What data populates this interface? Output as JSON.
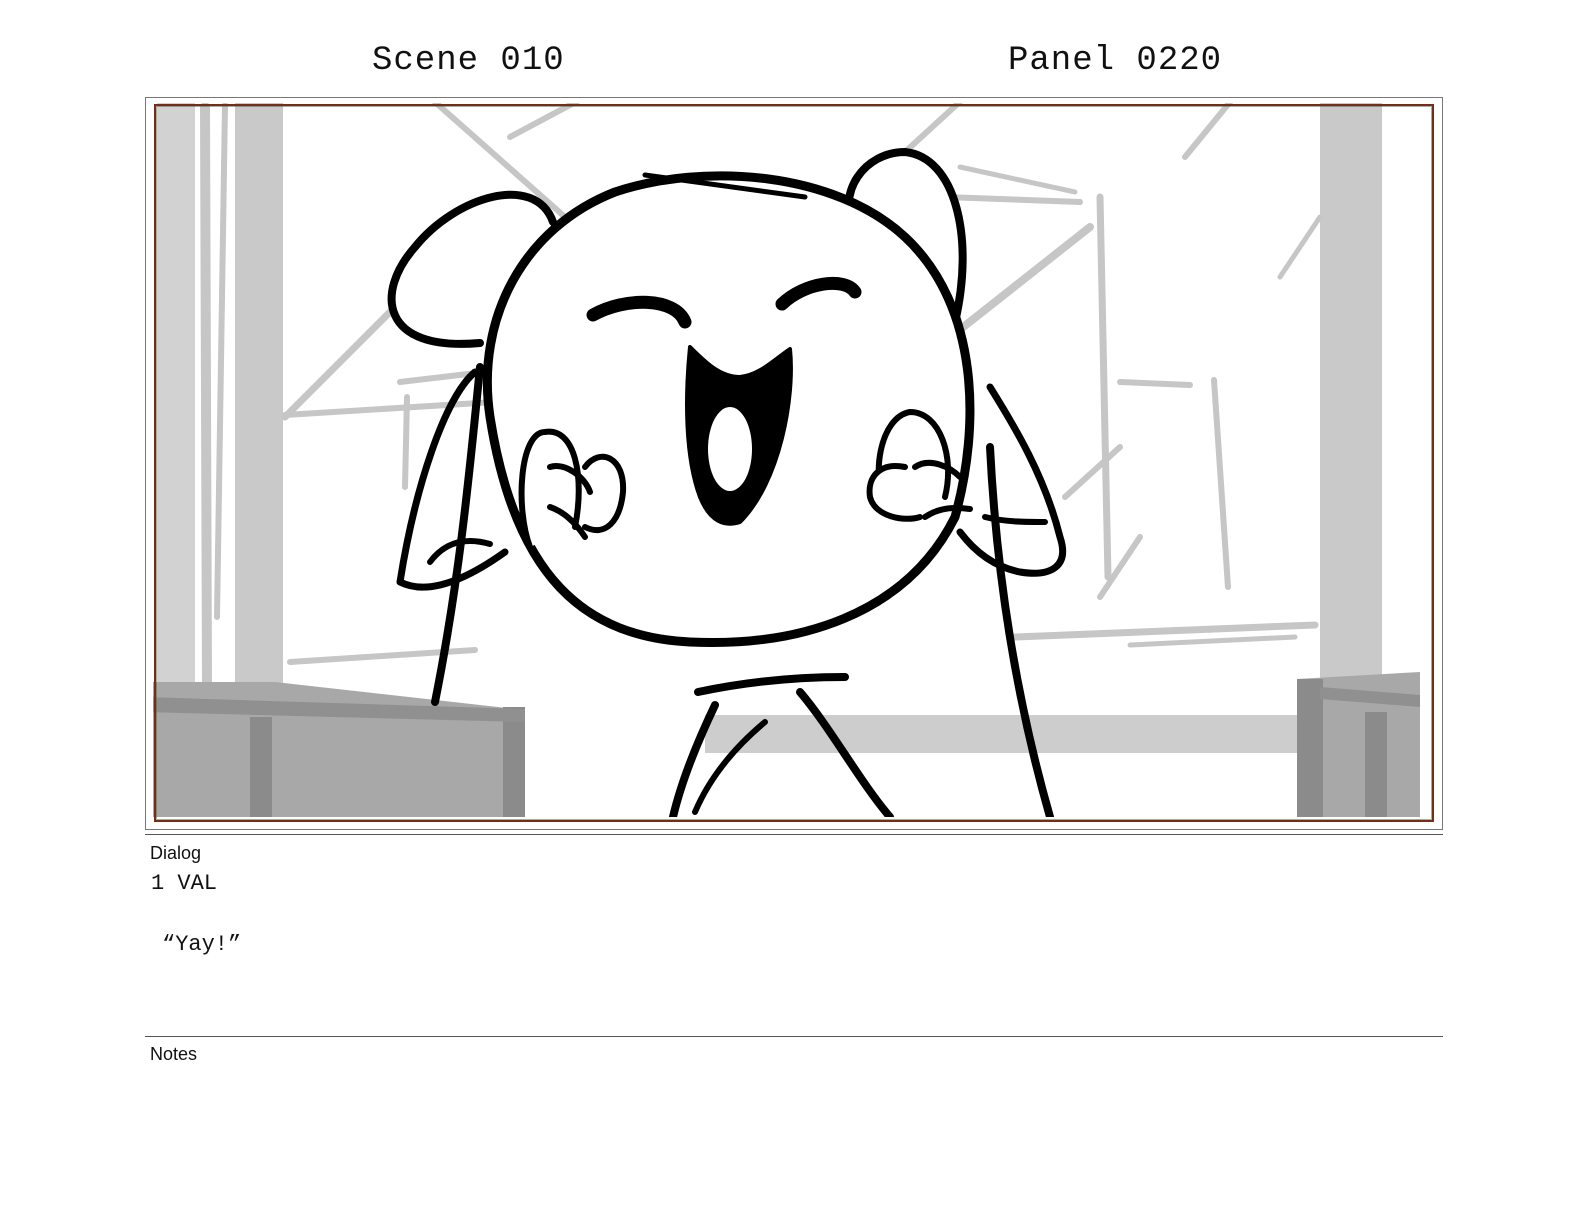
{
  "header": {
    "scene": "Scene 010",
    "panel": "Panel 0220"
  },
  "sections": {
    "dialog_label": "Dialog",
    "notes_label": "Notes"
  },
  "dialog": {
    "speaker": "1 VAL",
    "line": "“Yay!”"
  },
  "artwork": {
    "description_icon": "storyboard-drawing",
    "colors": {
      "ink": "#000000",
      "background_sketch": "#c6c6c6",
      "furniture": "#a9a9a9",
      "frame_border": "#7a2b17"
    }
  }
}
